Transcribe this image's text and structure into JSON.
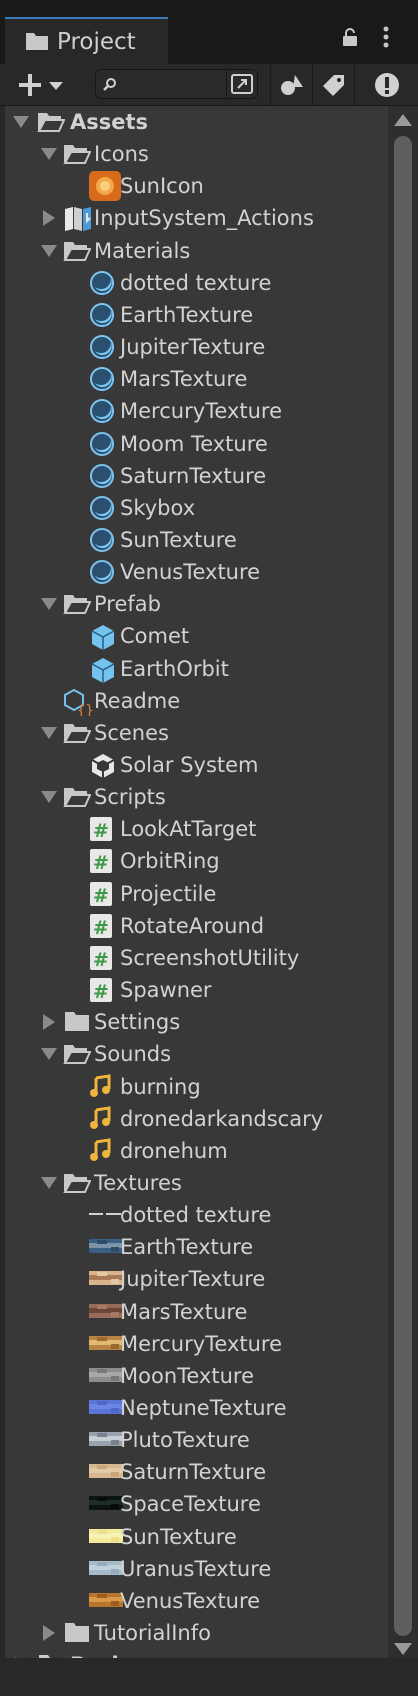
{
  "window": {
    "tab_title": "Project"
  },
  "toolbar": {
    "search_placeholder": ""
  },
  "tree": [
    {
      "label": "Assets",
      "icon": "folder-open-icon",
      "arrow": "open",
      "depth": 0,
      "bold": true
    },
    {
      "label": "Icons",
      "icon": "folder-open-icon",
      "arrow": "open",
      "depth": 1
    },
    {
      "label": "SunIcon",
      "icon": "sun-image-icon",
      "arrow": "none",
      "depth": 2
    },
    {
      "label": "InputSystem_Actions",
      "icon": "input-actions-icon",
      "arrow": "closed",
      "depth": 1
    },
    {
      "label": "Materials",
      "icon": "folder-open-icon",
      "arrow": "open",
      "depth": 1
    },
    {
      "label": "dotted texture",
      "icon": "material-sphere-icon",
      "arrow": "none",
      "depth": 2
    },
    {
      "label": "EarthTexture",
      "icon": "material-sphere-icon",
      "arrow": "none",
      "depth": 2
    },
    {
      "label": "JupiterTexture",
      "icon": "material-sphere-icon",
      "arrow": "none",
      "depth": 2
    },
    {
      "label": "MarsTexture",
      "icon": "material-sphere-icon",
      "arrow": "none",
      "depth": 2
    },
    {
      "label": "MercuryTexture",
      "icon": "material-sphere-icon",
      "arrow": "none",
      "depth": 2
    },
    {
      "label": "Moom Texture",
      "icon": "material-sphere-icon",
      "arrow": "none",
      "depth": 2
    },
    {
      "label": "SaturnTexture",
      "icon": "material-sphere-icon",
      "arrow": "none",
      "depth": 2
    },
    {
      "label": "Skybox",
      "icon": "material-sphere-icon",
      "arrow": "none",
      "depth": 2
    },
    {
      "label": "SunTexture",
      "icon": "material-sphere-icon",
      "arrow": "none",
      "depth": 2
    },
    {
      "label": "VenusTexture",
      "icon": "material-sphere-icon",
      "arrow": "none",
      "depth": 2
    },
    {
      "label": "Prefab",
      "icon": "folder-open-icon",
      "arrow": "open",
      "depth": 1
    },
    {
      "label": "Comet",
      "icon": "prefab-cube-icon",
      "arrow": "none",
      "depth": 2
    },
    {
      "label": "EarthOrbit",
      "icon": "prefab-cube-icon",
      "arrow": "none",
      "depth": 2
    },
    {
      "label": "Readme",
      "icon": "readme-icon",
      "arrow": "none",
      "depth": 1
    },
    {
      "label": "Scenes",
      "icon": "folder-open-icon",
      "arrow": "open",
      "depth": 1
    },
    {
      "label": "Solar System",
      "icon": "unity-scene-icon",
      "arrow": "none",
      "depth": 2
    },
    {
      "label": "Scripts",
      "icon": "folder-open-icon",
      "arrow": "open",
      "depth": 1
    },
    {
      "label": "LookAtTarget",
      "icon": "csharp-script-icon",
      "arrow": "none",
      "depth": 2
    },
    {
      "label": "OrbitRing",
      "icon": "csharp-script-icon",
      "arrow": "none",
      "depth": 2
    },
    {
      "label": "Projectile",
      "icon": "csharp-script-icon",
      "arrow": "none",
      "depth": 2
    },
    {
      "label": "RotateAround",
      "icon": "csharp-script-icon",
      "arrow": "none",
      "depth": 2
    },
    {
      "label": "ScreenshotUtility",
      "icon": "csharp-script-icon",
      "arrow": "none",
      "depth": 2
    },
    {
      "label": "Spawner",
      "icon": "csharp-script-icon",
      "arrow": "none",
      "depth": 2
    },
    {
      "label": "Settings",
      "icon": "folder-closed-icon",
      "arrow": "closed",
      "depth": 1
    },
    {
      "label": "Sounds",
      "icon": "folder-open-icon",
      "arrow": "open",
      "depth": 1
    },
    {
      "label": "burning",
      "icon": "audio-clip-icon",
      "arrow": "none",
      "depth": 2
    },
    {
      "label": "dronedarkandscary",
      "icon": "audio-clip-icon",
      "arrow": "none",
      "depth": 2
    },
    {
      "label": "dronehum",
      "icon": "audio-clip-icon",
      "arrow": "none",
      "depth": 2
    },
    {
      "label": "Textures",
      "icon": "folder-open-icon",
      "arrow": "open",
      "depth": 1
    },
    {
      "label": "dotted texture",
      "icon": "dotted-texture-icon",
      "arrow": "none",
      "depth": 2,
      "swatch": [
        "#d0d0d0",
        "#383838",
        "#d0d0d0"
      ]
    },
    {
      "label": "EarthTexture",
      "icon": "texture-thumbnail-icon",
      "arrow": "none",
      "depth": 2,
      "swatch": [
        "#3a5f82",
        "#7d94a8",
        "#2d4a67"
      ]
    },
    {
      "label": "JupiterTexture",
      "icon": "texture-thumbnail-icon",
      "arrow": "none",
      "depth": 2,
      "swatch": [
        "#d8b48d",
        "#a97a55",
        "#e2c9a6"
      ]
    },
    {
      "label": "MarsTexture",
      "icon": "texture-thumbnail-icon",
      "arrow": "none",
      "depth": 2,
      "swatch": [
        "#9a6a58",
        "#6d4538",
        "#a57a65"
      ]
    },
    {
      "label": "MercuryTexture",
      "icon": "texture-thumbnail-icon",
      "arrow": "none",
      "depth": 2,
      "swatch": [
        "#b88446",
        "#e0b870",
        "#9a6a32"
      ]
    },
    {
      "label": "MoonTexture",
      "icon": "texture-thumbnail-icon",
      "arrow": "none",
      "depth": 2,
      "swatch": [
        "#8d8d8d",
        "#a8a8a8",
        "#777777"
      ]
    },
    {
      "label": "NeptuneTexture",
      "icon": "texture-thumbnail-icon",
      "arrow": "none",
      "depth": 2,
      "swatch": [
        "#5b74d6",
        "#6d86e4",
        "#4f67c8"
      ]
    },
    {
      "label": "PlutoTexture",
      "icon": "texture-thumbnail-icon",
      "arrow": "none",
      "depth": 2,
      "swatch": [
        "#9aa2ad",
        "#c9ced4",
        "#7a828d"
      ]
    },
    {
      "label": "SaturnTexture",
      "icon": "texture-thumbnail-icon",
      "arrow": "none",
      "depth": 2,
      "swatch": [
        "#d7b890",
        "#e4caa4",
        "#c9a57a"
      ]
    },
    {
      "label": "SpaceTexture",
      "icon": "texture-thumbnail-icon",
      "arrow": "none",
      "depth": 2,
      "swatch": [
        "#0c1410",
        "#1e2e24",
        "#070b09"
      ]
    },
    {
      "label": "SunTexture",
      "icon": "texture-thumbnail-icon",
      "arrow": "none",
      "depth": 2,
      "swatch": [
        "#f3ea9a",
        "#f8f2b6",
        "#ece08a"
      ]
    },
    {
      "label": "UranusTexture",
      "icon": "texture-thumbnail-icon",
      "arrow": "none",
      "depth": 2,
      "swatch": [
        "#a7bcc9",
        "#bdd0dc",
        "#96acba"
      ]
    },
    {
      "label": "VenusTexture",
      "icon": "texture-thumbnail-icon",
      "arrow": "none",
      "depth": 2,
      "swatch": [
        "#b8752e",
        "#d99a4a",
        "#9a5e22"
      ]
    },
    {
      "label": "TutorialInfo",
      "icon": "folder-closed-icon",
      "arrow": "closed",
      "depth": 1
    },
    {
      "label": "Packages",
      "icon": "folder-closed-icon",
      "arrow": "closed",
      "depth": 0,
      "bold": true
    }
  ],
  "colors": {
    "folder": "#c8c8c8",
    "material": "#7cc4f2",
    "prefab": "#74c3ef",
    "script": "#3f9a46",
    "audio": "#f0b43c",
    "tab_accent": "#3a79bb"
  }
}
